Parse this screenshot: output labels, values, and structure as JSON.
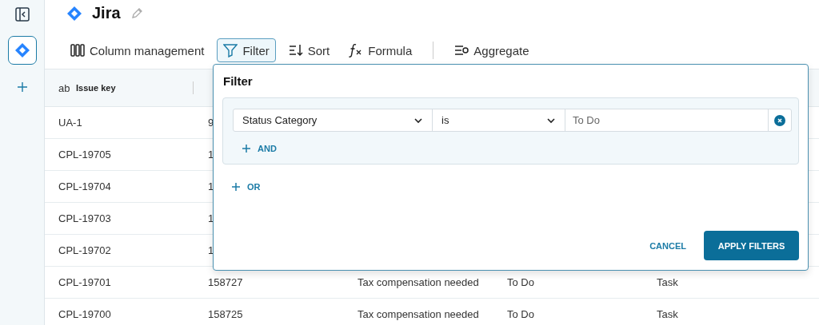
{
  "app": {
    "title": "Jira"
  },
  "toolbar": [
    {
      "kind": "columns",
      "label": "Column management",
      "selected": false
    },
    {
      "kind": "filter",
      "label": "Filter",
      "selected": true
    },
    {
      "kind": "sort",
      "label": "Sort",
      "selected": false
    },
    {
      "kind": "formula",
      "label": "Formula",
      "selected": false
    },
    {
      "kind": "aggregate",
      "label": "Aggregate",
      "selected": false
    }
  ],
  "table": {
    "columns": [
      {
        "label": "Issue key",
        "type": "ab"
      }
    ],
    "rows": [
      {
        "cells": [
          "UA-1",
          "9"
        ]
      },
      {
        "cells": [
          "CPL-19705",
          "1"
        ]
      },
      {
        "cells": [
          "CPL-19704",
          "1"
        ]
      },
      {
        "cells": [
          "CPL-19703",
          "1"
        ]
      },
      {
        "cells": [
          "CPL-19702",
          "1"
        ]
      },
      {
        "cells": [
          "CPL-19701",
          "158727",
          "Tax compensation needed",
          "To Do",
          "Task"
        ]
      },
      {
        "cells": [
          "CPL-19700",
          "158725",
          "Tax compensation needed",
          "To Do",
          "Task"
        ]
      }
    ]
  },
  "filter_panel": {
    "title": "Filter",
    "conditions": [
      {
        "field": "Status Category",
        "operator": "is",
        "value": "To Do"
      }
    ],
    "and_label": "AND",
    "or_label": "OR",
    "buttons": [
      {
        "kind": "secondary",
        "label": "CANCEL"
      },
      {
        "kind": "primary",
        "label": "APPLY FILTERS"
      }
    ]
  }
}
